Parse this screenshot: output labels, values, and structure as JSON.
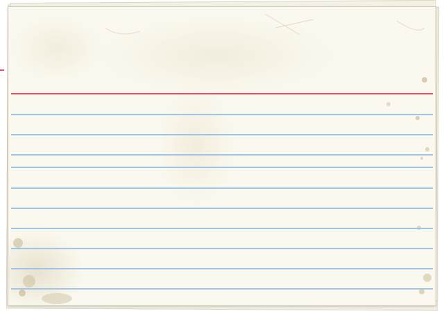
{
  "card": {
    "paper_color": "#fbf9ef",
    "header_rule_color": "#e0525f",
    "line_rule_color": "#9fc4ea",
    "rule_count": 10
  },
  "icons": {
    "stain": "coffee-stain-icon"
  }
}
